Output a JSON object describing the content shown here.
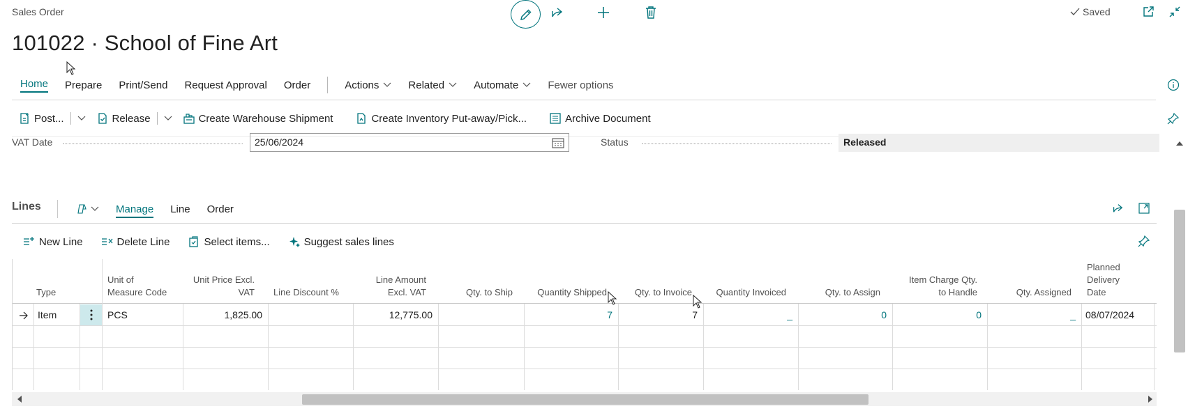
{
  "header": {
    "page_kind": "Sales Order",
    "title": "101022 · School of Fine Art",
    "saved_label": "Saved"
  },
  "menu": {
    "items": [
      "Home",
      "Prepare",
      "Print/Send",
      "Request Approval",
      "Order"
    ],
    "dropdowns": [
      "Actions",
      "Related",
      "Automate"
    ],
    "fewer_options": "Fewer options"
  },
  "actions": {
    "post": "Post...",
    "release": "Release",
    "create_warehouse_shipment": "Create Warehouse Shipment",
    "create_inventory": "Create Inventory Put-away/Pick...",
    "archive_document": "Archive Document"
  },
  "fields": {
    "vat_date_label": "VAT Date",
    "vat_date_value": "25/06/2024",
    "status_label": "Status",
    "status_value": "Released"
  },
  "lines": {
    "title": "Lines",
    "tabs": [
      "Manage",
      "Line",
      "Order"
    ],
    "actions": {
      "new_line": "New Line",
      "delete_line": "Delete Line",
      "select_items": "Select items...",
      "suggest": "Suggest sales lines"
    },
    "columns": {
      "type": "Type",
      "uom": [
        "Unit of",
        "Measure Code"
      ],
      "unit_price": [
        "Unit Price Excl.",
        "VAT"
      ],
      "line_discount": "Line Discount %",
      "line_amount": [
        "Line Amount",
        "Excl. VAT"
      ],
      "qty_to_ship": "Qty. to Ship",
      "qty_shipped": "Quantity Shipped",
      "qty_to_invoice": "Qty. to Invoice",
      "qty_invoiced": "Quantity Invoiced",
      "qty_to_assign": "Qty. to Assign",
      "item_charge": [
        "Item Charge Qty.",
        "to Handle"
      ],
      "qty_assigned": "Qty. Assigned",
      "planned_delivery": [
        "Planned",
        "Delivery",
        "Date"
      ]
    },
    "row": {
      "type": "Item",
      "uom": "PCS",
      "unit_price": "1,825.00",
      "line_discount": "",
      "line_amount": "12,775.00",
      "qty_to_ship": "",
      "qty_shipped": "7",
      "qty_to_invoice": "7",
      "qty_invoiced": "_",
      "qty_to_assign": "0",
      "item_charge": "0",
      "qty_assigned": "_",
      "planned_delivery": "08/07/2024"
    }
  },
  "colors": {
    "accent": "#00747c",
    "border": "#d6d6d6"
  }
}
